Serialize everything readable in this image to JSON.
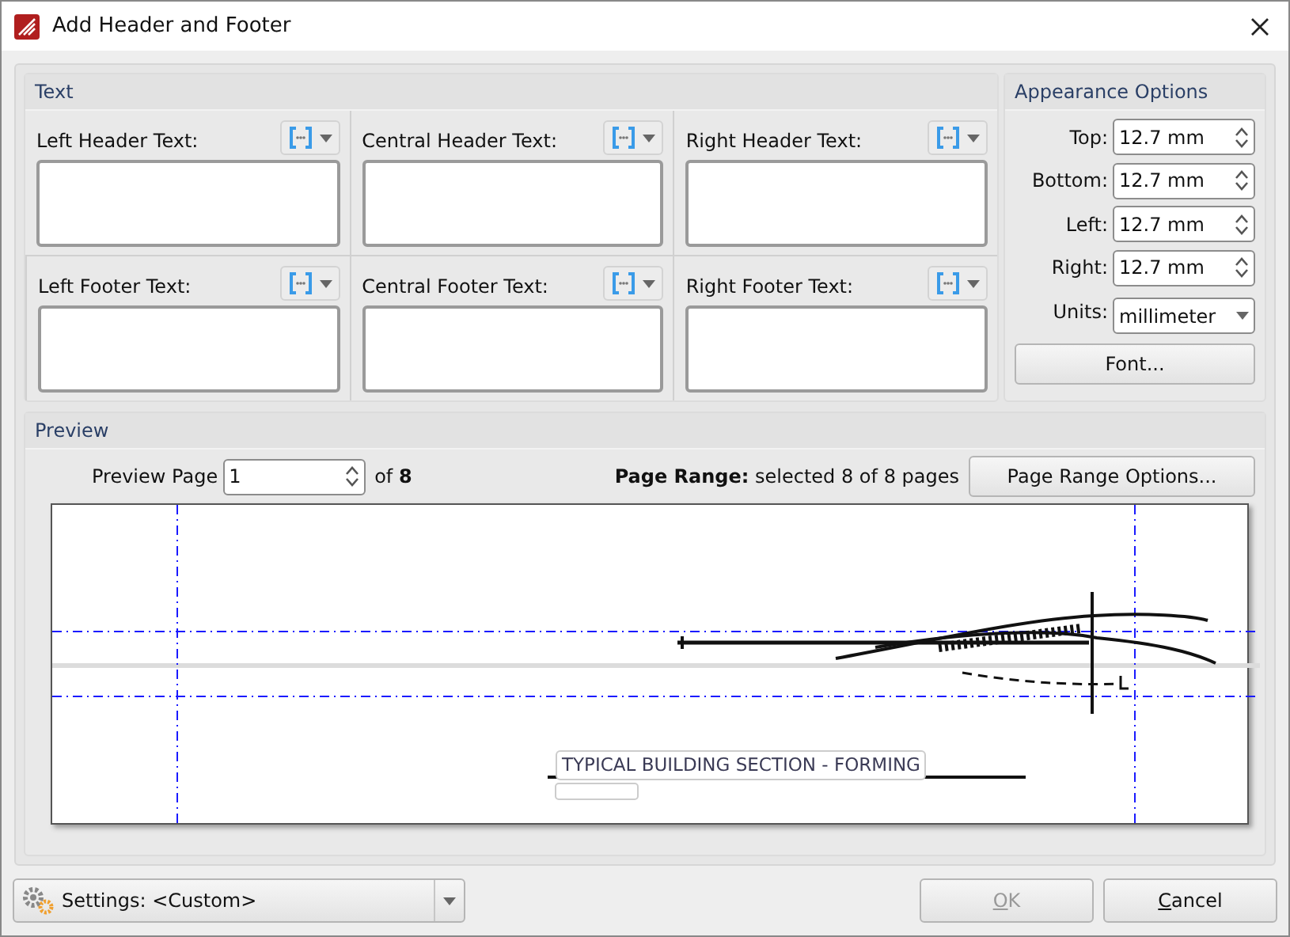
{
  "window": {
    "title": "Add Header and Footer"
  },
  "text_group": {
    "title": "Text",
    "cells": [
      {
        "label": "Left Header Text:"
      },
      {
        "label": "Central Header Text:"
      },
      {
        "label": "Right Header Text:"
      },
      {
        "label": "Left Footer Text:"
      },
      {
        "label": "Central Footer Text:"
      },
      {
        "label": "Right Footer Text:"
      }
    ]
  },
  "appearance": {
    "title": "Appearance Options",
    "fields": [
      {
        "kind": "spin",
        "label": "Top:",
        "value": "12.7 mm"
      },
      {
        "kind": "spin",
        "label": "Bottom:",
        "value": "12.7 mm"
      },
      {
        "kind": "spin",
        "label": "Left:",
        "value": "12.7 mm"
      },
      {
        "kind": "spin",
        "label": "Right:",
        "value": "12.7 mm"
      },
      {
        "kind": "select",
        "label": "Units:",
        "value": "millimeter"
      }
    ],
    "font_button": "Font..."
  },
  "preview": {
    "title": "Preview",
    "page_label": "Preview Page",
    "page_value": "1",
    "of_text": "of **8**",
    "page_range": "**Page Range:** selected 8 of 8 pages",
    "range_button": "Page Range Options...",
    "document_caption": "TYPICAL BUILDING SECTION - FORMING"
  },
  "footer": {
    "settings_label": "Settings:",
    "settings_value": "<Custom>",
    "buttons": [
      {
        "label": "OK",
        "disabled": true
      },
      {
        "label": "Cancel",
        "disabled": false
      }
    ]
  }
}
